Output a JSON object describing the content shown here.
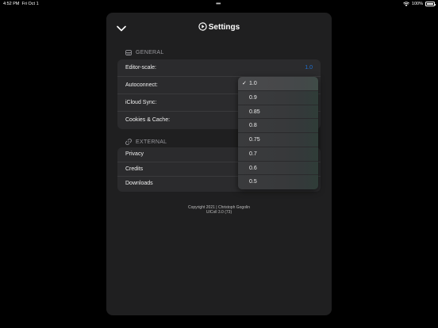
{
  "status_bar": {
    "time": "4:52 PM",
    "date": "Fri Oct 1",
    "battery": "100%"
  },
  "header": {
    "title": "Settings"
  },
  "general": {
    "header": "GENERAL",
    "rows": [
      {
        "label": "Editor-scale:",
        "value": "1.0"
      },
      {
        "label": "Autoconnect:"
      },
      {
        "label": "iCloud Sync:"
      },
      {
        "label": "Cookies & Cache:"
      }
    ]
  },
  "external": {
    "header": "EXTERNAL",
    "rows": [
      {
        "label": "Privacy"
      },
      {
        "label": "Credits"
      },
      {
        "label": "Downloads"
      }
    ]
  },
  "footer": {
    "copyright": "Copyright 2021 | Christoph Gogolin",
    "version": "UIColl 3.0 (73)"
  },
  "scale_menu": {
    "selected": "1.0",
    "check_mark": "✓",
    "options": [
      "1.0",
      "0.9",
      "0.85",
      "0.8",
      "0.75",
      "0.7",
      "0.6",
      "0.5"
    ]
  },
  "colors": {
    "accent": "#1f6fd0",
    "panel": "#1f1f20",
    "group": "#2b2b2d"
  }
}
